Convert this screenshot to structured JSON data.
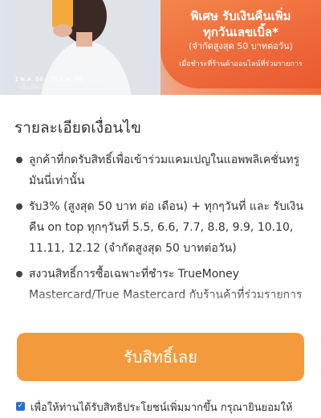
{
  "banner": {
    "line1": "พิเศษ รับเงินคืนเพิ่ม",
    "line2": "ทุกวันเลขเบิ้ล*",
    "line3": "(จำกัดสูงสุด 50 บาทต่อวัน)",
    "line4": "เมื่อชำระที่ร้านค้าออนไลน์ที่ร่วมรายการ",
    "date": "1 พ.ค. 66 - 31 ธ.ค. 66",
    "note": "*เงื่อนไขเป็นไปตามที่บริษัทฯ กำหนด"
  },
  "section": {
    "title": "รายละเอียดเงื่อนไข"
  },
  "conditions": [
    "ลูกค้าที่กดรับสิทธิ์เพื่อเข้าร่วมแคมเปญในแอพพลิเคชั่นทรูมันนี่เท่านั้น",
    "รับ3% (สูงสุด 50 บาท ต่อ เดือน) + ทุกๆวันที่ และ รับเงินคืน on top ทุกๆวันที่ 5.5, 6.6, 7.7, 8.8, 9.9, 10.10, 11.11, 12.12 (จำกัดสูงสุด 50 บาทต่อวัน)",
    "สงวนสิทธิ์การซื้อเฉพาะที่ชำระ TrueMoney Mastercard/True Mastercard กับร้านค้าที่ร่วมรายการ"
  ],
  "cta": {
    "label": "รับสิทธิ์เลย"
  },
  "consent": {
    "text": "เพื่อให้ท่านได้รับสิทธิประโยชน์เพิ่มมากขึ้น กรุณายินยอมให้"
  },
  "colors": {
    "accent": "#f39a3c",
    "banner_orange": "#ef6f3c",
    "checkbox": "#2b6fd6"
  }
}
